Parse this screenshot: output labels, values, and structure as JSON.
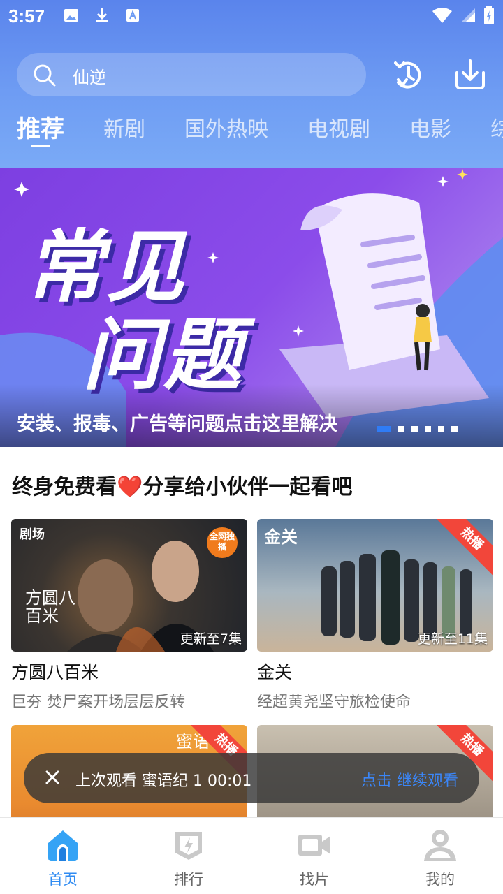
{
  "status_bar": {
    "time": "3:57"
  },
  "search": {
    "query": "仙逆"
  },
  "tabs": [
    {
      "label": "推荐",
      "active": true
    },
    {
      "label": "新剧"
    },
    {
      "label": "国外热映"
    },
    {
      "label": "电视剧"
    },
    {
      "label": "电影"
    },
    {
      "label": "综"
    }
  ],
  "banner": {
    "title_line1": "常见",
    "title_line2": "问题",
    "caption": "安装、报毒、广告等问题点击这里解决",
    "slide_count": 6,
    "active_slide": 1
  },
  "section": {
    "title": "终身免费看❤️分享给小伙伴一起看吧"
  },
  "cards": [
    {
      "title": "方圆八百米",
      "subtitle": "巨夯 焚尸案开场层层反转",
      "badge": "更新至7集",
      "brand": "剧场",
      "tag": "全网独播"
    },
    {
      "title": "金关",
      "subtitle": "经超黄尧坚守旅检使命",
      "badge": "更新至11集",
      "poster_title": "金关",
      "ribbon": "热播"
    },
    {
      "ribbon": "热播",
      "poster_title": "蜜语"
    },
    {
      "ribbon": "热播"
    }
  ],
  "resume": {
    "text": "上次观看 蜜语纪 1  00:01",
    "action": "点击 继续观看"
  },
  "bottom_nav": [
    {
      "label": "首页",
      "icon": "home-icon",
      "active": true
    },
    {
      "label": "排行",
      "icon": "ranking-icon"
    },
    {
      "label": "找片",
      "icon": "video-camera-icon"
    },
    {
      "label": "我的",
      "icon": "profile-icon"
    }
  ],
  "colors": {
    "accent": "#2f8bf2",
    "header": "#6e9cf3",
    "hot": "#f2463a"
  }
}
